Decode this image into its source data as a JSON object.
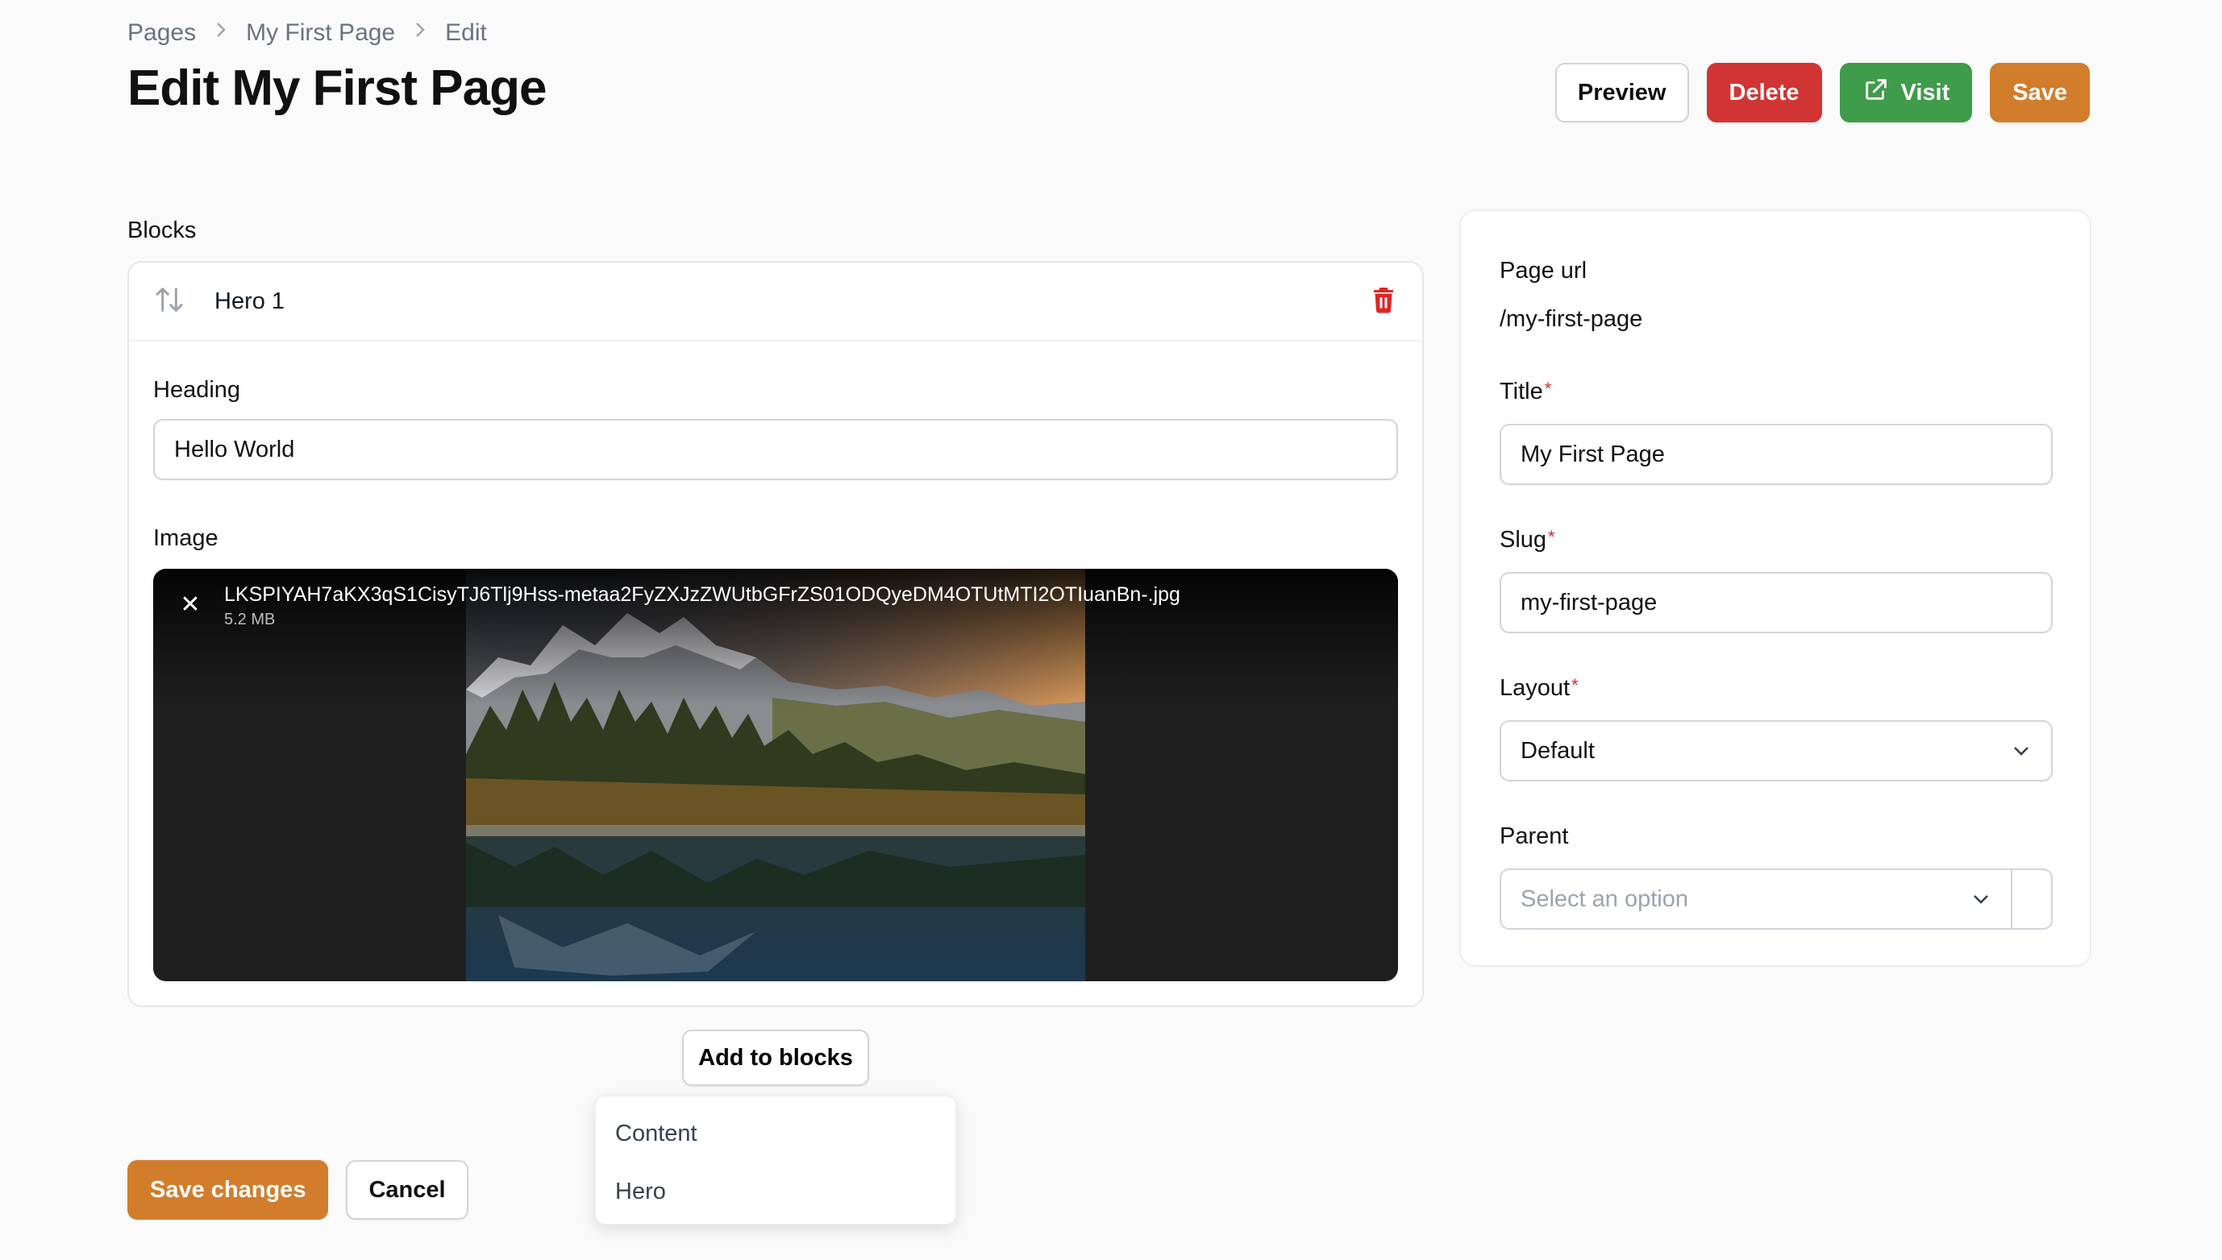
{
  "breadcrumb": [
    "Pages",
    "My First Page",
    "Edit"
  ],
  "page_title": "Edit My First Page",
  "header_actions": {
    "preview": "Preview",
    "delete": "Delete",
    "visit": "Visit",
    "save": "Save"
  },
  "blocks": {
    "label": "Blocks",
    "block_title": "Hero 1",
    "heading_label": "Heading",
    "heading_value": "Hello World",
    "image_label": "Image",
    "file_name": "LKSPIYAH7aKX3qS1CisyTJ6Tlj9Hss-metaa2FyZXJzZWUtbGFrZS01ODQyeDM4OTUtMTI2OTIuanBn-.jpg",
    "file_size": "5.2 MB",
    "add_button": "Add to blocks",
    "menu_items": [
      "Content",
      "Hero"
    ]
  },
  "footer": {
    "save_changes": "Save changes",
    "cancel": "Cancel"
  },
  "sidebar": {
    "page_url_label": "Page url",
    "page_url_value": "/my-first-page",
    "title_label": "Title",
    "title_value": "My First Page",
    "slug_label": "Slug",
    "slug_value": "my-first-page",
    "layout_label": "Layout",
    "layout_value": "Default",
    "parent_label": "Parent",
    "parent_placeholder": "Select an option",
    "required_mark": "*"
  },
  "colors": {
    "primary": "#d27d2c",
    "danger": "#d13434",
    "success": "#3f9c4a"
  },
  "icons": [
    "chevron-right-icon",
    "sort-arrows-icon",
    "trash-icon",
    "external-link-icon",
    "close-icon",
    "chevron-down-icon"
  ]
}
